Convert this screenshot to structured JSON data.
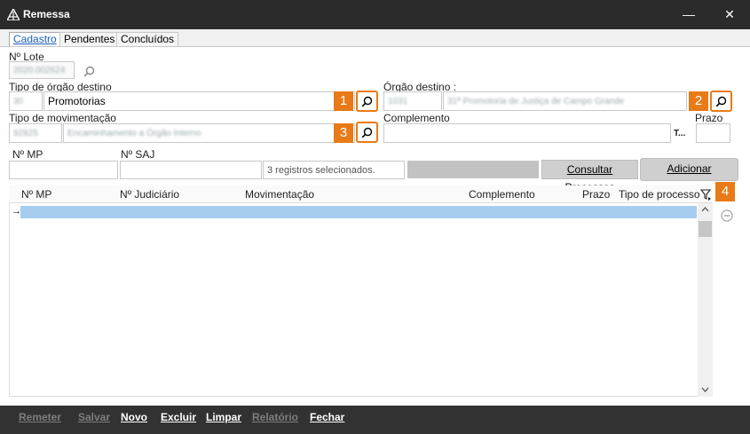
{
  "window": {
    "title": "Remessa",
    "minimize_glyph": "—",
    "maximize_glyph": "☐",
    "close_glyph": "✕"
  },
  "tabs": [
    {
      "label": "Cadastro"
    },
    {
      "label": "Pendentes"
    },
    {
      "label": "Concluídos"
    }
  ],
  "form": {
    "lote_label": "Nº Lote",
    "lote_value": "2020.002624",
    "tipo_orgao_label": "Tipo de órgão destino",
    "tipo_orgao_code": "30",
    "tipo_orgao_value": "Promotorias",
    "orgao_label": "Órgão destino :",
    "orgao_code": "1031",
    "orgao_value": "31ª Promotoria de Justiça de Campo Grande",
    "tipo_mov_label": "Tipo de movimentação",
    "tipo_mov_code": "92825",
    "tipo_mov_value": "Encaminhamento a Órgão Interno",
    "complemento_label": "Complemento",
    "t_label": "T...",
    "prazo_label": "Prazo",
    "nmp_label": "Nº MP",
    "nsaj_label": "Nº SAJ",
    "registros_text": "3 registros selecionados.",
    "consultar_label": "Consultar Processos",
    "adicionar_label": "Adicionar"
  },
  "badges": [
    "1",
    "2",
    "3",
    "4"
  ],
  "grid": {
    "columns": [
      "Nº MP",
      "Nº Judiciário",
      "Movimentação",
      "Complemento",
      "Prazo",
      "Tipo de processo"
    ],
    "row_indicator": "→"
  },
  "footer": [
    {
      "label": "Remeter",
      "enabled": false
    },
    {
      "label": "Salvar",
      "enabled": false
    },
    {
      "label": "Novo",
      "enabled": true
    },
    {
      "label": "Excluir",
      "enabled": true
    },
    {
      "label": "Limpar",
      "enabled": true
    },
    {
      "label": "Relatório",
      "enabled": false
    },
    {
      "label": "Fechar",
      "enabled": true
    }
  ],
  "colors": {
    "accent": "#e87a17",
    "selection": "#a6cdef",
    "titlebar": "#2b2b2b",
    "footer": "#323232"
  }
}
